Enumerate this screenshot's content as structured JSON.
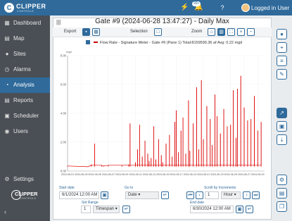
{
  "app": {
    "brand": "CLIPPER",
    "brand_sub": "CONTROLS",
    "notification_count": "99+",
    "user_label": "Logged in User"
  },
  "topbar_icons": [
    "activity-icon",
    "bell-icon",
    "help-icon"
  ],
  "sidebar": {
    "items": [
      {
        "label": "Dashboard",
        "icon": "grid-icon",
        "active": false
      },
      {
        "label": "Map",
        "icon": "map-icon",
        "active": false
      },
      {
        "label": "Sites",
        "icon": "pin-icon",
        "active": false
      },
      {
        "label": "Alarms",
        "icon": "alarm-icon",
        "active": false
      },
      {
        "label": "Analysis",
        "icon": "chart-icon",
        "active": true
      },
      {
        "label": "Reports",
        "icon": "report-icon",
        "active": false
      },
      {
        "label": "Scheduler",
        "icon": "calendar-icon",
        "active": false
      },
      {
        "label": "Users",
        "icon": "users-icon",
        "active": false
      }
    ],
    "settings_label": "Settings",
    "logo_text": "CLIPPER",
    "logo_sub": "CONTROLS",
    "collapse": "‹"
  },
  "panel": {
    "title": "Gate #9 (2024-06-28 13:47:27) - Daily Max",
    "toolbar": {
      "export_label": "Export",
      "selection_label": "Selection",
      "zoom_label": "Zoom"
    },
    "legend": "Flow Rate - Signature Meter - Gate #9 (Pane 1) Total:8159599.36 af  Avg: 0.22 mgd"
  },
  "chart_data": {
    "type": "line",
    "ylabel": "mgd",
    "yticks": [
      "0.00",
      "2.00",
      "4.00",
      "6.00",
      "8.00"
    ],
    "ylim": [
      0,
      8
    ],
    "xticks": [
      "2024-06-01",
      "2024-06-03",
      "2024-06-05",
      "2024-06-07",
      "2024-06-09",
      "2024-06-11",
      "2024-06-13",
      "2024-06-15",
      "2024-06-17",
      "2024-06-19",
      "2024-06-21",
      "2024-06-23",
      "2024-06-25",
      "2024-06-27",
      "2024-06-29"
    ],
    "series": [
      {
        "color": "#dd0000",
        "x": [
          "06-01",
          "06-04",
          "06-04.5",
          "06-05",
          "06-06",
          "06-06.3",
          "06-07",
          "06-09",
          "06-10",
          "06-10.2",
          "06-11",
          "06-11.3",
          "06-11.6",
          "06-12",
          "06-12.4",
          "06-12.8",
          "06-13",
          "06-13.3",
          "06-13.7",
          "06-14",
          "06-14.4",
          "06-14.8",
          "06-15",
          "06-15.5",
          "06-16",
          "06-16.4",
          "06-16.8",
          "06-17",
          "06-17.3",
          "06-17.7",
          "06-18",
          "06-18.4",
          "06-18.8",
          "06-19",
          "06-19.5",
          "06-20",
          "06-20.3",
          "06-20.7",
          "06-21",
          "06-21.5",
          "06-22",
          "06-22.3",
          "06-22.7",
          "06-23",
          "06-23.5",
          "06-24",
          "06-24.5",
          "06-25",
          "06-25.4",
          "06-25.8",
          "06-26",
          "06-26.5",
          "06-27",
          "06-27.5",
          "06-28",
          "06-28.5",
          "06-29",
          "06-29.5"
        ],
        "y": [
          0.35,
          0.3,
          0.45,
          1.9,
          0.4,
          0.35,
          0.4,
          0.4,
          0.45,
          3.3,
          0.6,
          1.5,
          3.2,
          1.0,
          2.1,
          1.2,
          0.7,
          0.9,
          3.1,
          0.8,
          2.2,
          1.1,
          0.6,
          1.9,
          2.5,
          1.0,
          3.4,
          4.2,
          1.3,
          2.8,
          3.7,
          1.2,
          4.9,
          1.4,
          3.3,
          5.8,
          1.5,
          6.3,
          2.2,
          4.5,
          3.6,
          1.8,
          5.3,
          3.8,
          2.6,
          4.3,
          3.1,
          3.2,
          5.6,
          2.3,
          5.7,
          6.6,
          4.4,
          3.5,
          3.6,
          5.2,
          2.8,
          3.4
        ]
      }
    ]
  },
  "controls": {
    "start_date_label": "Start date",
    "start_date": "6/1/2024 12:00 AM",
    "set_range_label": "Set Range",
    "range_value": "1",
    "range_unit": "Timespan",
    "goto_label": "Go to",
    "goto_value": "Date",
    "scroll_label": "Scroll by Increments",
    "scroll_value": "1",
    "scroll_unit": "Hour",
    "end_date_label": "End date",
    "end_date": "6/30/2024 12:00 AM"
  }
}
